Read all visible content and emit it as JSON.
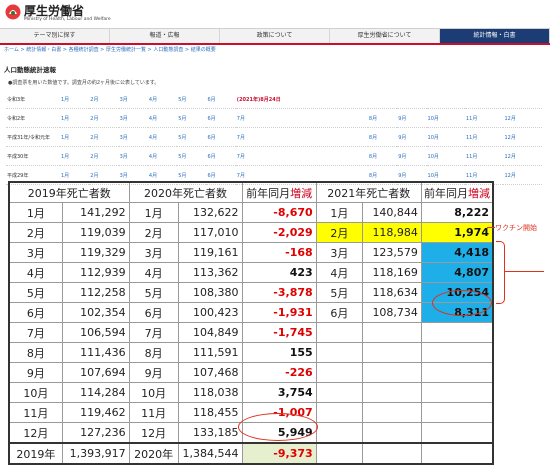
{
  "site": {
    "title": "厚生労働省",
    "subtitle": "Ministry of Health, Labour and Welfare"
  },
  "nav": [
    "テーマ別に探す",
    "報道・広報",
    "政策について",
    "厚生労働省について",
    "統計情報・白書"
  ],
  "breadcrumb": "ホーム > 統計情報・白書 > 各種統計調査 > 厚生労働統計一覧 > 人口動態調査 > 結果の概要",
  "section_title": "人口動態統計速報",
  "note": "●調査票を用いた数値です。調査月の約2ヶ月後に公表しています。",
  "month_links": {
    "rows": [
      {
        "label": "令和3年",
        "months": [
          "1月",
          "2月",
          "3月",
          "4月",
          "5月",
          "6月"
        ],
        "extra": "(2021年)8月24日"
      },
      {
        "label": "令和2年",
        "months": [
          "1月",
          "2月",
          "3月",
          "4月",
          "5月",
          "6月",
          "7月",
          "8月",
          "9月",
          "10月",
          "11月",
          "12月"
        ]
      },
      {
        "label": "平成31年/令和元年",
        "months": [
          "1月",
          "2月",
          "3月",
          "4月",
          "5月",
          "6月",
          "7月",
          "8月",
          "9月",
          "10月",
          "11月",
          "12月"
        ]
      },
      {
        "label": "平成30年",
        "months": [
          "1月",
          "2月",
          "3月",
          "4月",
          "5月",
          "6月",
          "7月",
          "8月",
          "9月",
          "10月",
          "11月",
          "12月"
        ]
      },
      {
        "label": "平成29年",
        "months": [
          "1月",
          "2月",
          "3月",
          "4月",
          "5月",
          "6月",
          "7月",
          "8月",
          "9月",
          "10月",
          "11月",
          "12月"
        ]
      }
    ]
  },
  "table": {
    "headers": {
      "h2019": "2019年死亡者数",
      "h2020": "2020年死亡者数",
      "change_prefix": "前年同月",
      "change_suffix": "増減",
      "h2021": "2021年死亡者数"
    },
    "rows": [
      {
        "m19": "1月",
        "v19": "141,292",
        "m20": "1月",
        "v20": "132,622",
        "d20": "-8,670",
        "m21": "1月",
        "v21": "140,844",
        "d21": "8,222"
      },
      {
        "m19": "2月",
        "v19": "119,039",
        "m20": "2月",
        "v20": "117,010",
        "d20": "-2,029",
        "m21": "2月",
        "v21": "118,984",
        "d21": "1,974"
      },
      {
        "m19": "3月",
        "v19": "119,329",
        "m20": "3月",
        "v20": "119,161",
        "d20": "-168",
        "m21": "3月",
        "v21": "123,579",
        "d21": "4,418"
      },
      {
        "m19": "4月",
        "v19": "112,939",
        "m20": "4月",
        "v20": "113,362",
        "d20": "423",
        "m21": "4月",
        "v21": "118,169",
        "d21": "4,807"
      },
      {
        "m19": "5月",
        "v19": "112,258",
        "m20": "5月",
        "v20": "108,380",
        "d20": "-3,878",
        "m21": "5月",
        "v21": "118,634",
        "d21": "10,254"
      },
      {
        "m19": "6月",
        "v19": "102,354",
        "m20": "6月",
        "v20": "100,423",
        "d20": "-1,931",
        "m21": "6月",
        "v21": "108,734",
        "d21": "8,311"
      },
      {
        "m19": "7月",
        "v19": "106,594",
        "m20": "7月",
        "v20": "104,849",
        "d20": "-1,745",
        "m21": "",
        "v21": "",
        "d21": ""
      },
      {
        "m19": "8月",
        "v19": "111,436",
        "m20": "8月",
        "v20": "111,591",
        "d20": "155",
        "m21": "",
        "v21": "",
        "d21": ""
      },
      {
        "m19": "9月",
        "v19": "107,694",
        "m20": "9月",
        "v20": "107,468",
        "d20": "-226",
        "m21": "",
        "v21": "",
        "d21": ""
      },
      {
        "m19": "10月",
        "v19": "114,284",
        "m20": "10月",
        "v20": "118,038",
        "d20": "3,754",
        "m21": "",
        "v21": "",
        "d21": ""
      },
      {
        "m19": "11月",
        "v19": "119,462",
        "m20": "11月",
        "v20": "118,455",
        "d20": "-1,007",
        "m21": "",
        "v21": "",
        "d21": ""
      },
      {
        "m19": "12月",
        "v19": "127,236",
        "m20": "12月",
        "v20": "133,185",
        "d20": "5,949",
        "m21": "",
        "v21": "",
        "d21": ""
      }
    ],
    "total": {
      "y19": "2019年",
      "v19": "1,393,917",
      "y20": "2020年",
      "v20": "1,384,544",
      "d20": "-9,373"
    }
  },
  "annotation": {
    "vaccine": "ワクチン開始"
  },
  "colors": {
    "negative": "#e00000",
    "highlight_yellow": "#ffff00",
    "highlight_blue": "#1eaee8",
    "annotation": "#e0301e",
    "nav_active": "#1b3c74"
  }
}
